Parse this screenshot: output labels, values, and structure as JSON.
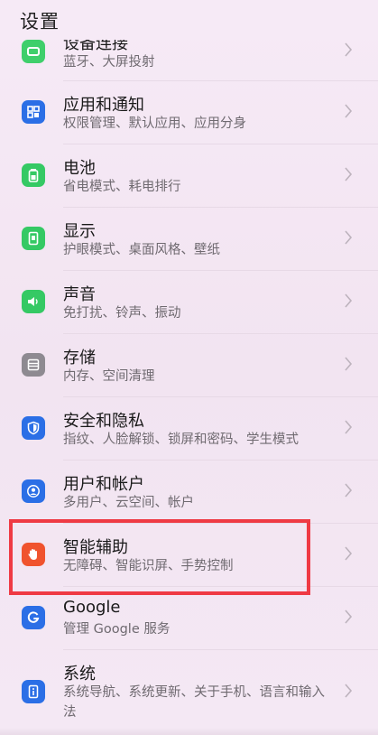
{
  "header": {
    "title": "设置"
  },
  "settings": [
    {
      "title": "设备连接",
      "subtitle": "蓝牙、大屏投射",
      "icon": "device-connection-icon",
      "color": "#3fcf6b"
    },
    {
      "title": "应用和通知",
      "subtitle": "权限管理、默认应用、应用分身",
      "icon": "apps-icon",
      "color": "#2b6fe6"
    },
    {
      "title": "电池",
      "subtitle": "省电模式、耗电排行",
      "icon": "battery-icon",
      "color": "#35c964"
    },
    {
      "title": "显示",
      "subtitle": "护眼模式、桌面风格、壁纸",
      "icon": "display-icon",
      "color": "#35c964"
    },
    {
      "title": "声音",
      "subtitle": "免打扰、铃声、振动",
      "icon": "sound-icon",
      "color": "#35c964"
    },
    {
      "title": "存储",
      "subtitle": "内存、空间清理",
      "icon": "storage-icon",
      "color": "#8e8a91"
    },
    {
      "title": "安全和隐私",
      "subtitle": "指纹、人脸解锁、锁屏和密码、学生模式",
      "icon": "shield-icon",
      "color": "#2b6fe6"
    },
    {
      "title": "用户和帐户",
      "subtitle": "多用户、云空间、帐户",
      "icon": "user-icon",
      "color": "#2b6fe6"
    },
    {
      "title": "智能辅助",
      "subtitle": "无障碍、智能识屏、手势控制",
      "icon": "hand-icon",
      "color": "#f0532e"
    },
    {
      "title": "Google",
      "subtitle": "管理 Google 服务",
      "icon": "google-icon",
      "color": "#2b6fe6"
    },
    {
      "title": "系统",
      "subtitle": "系统导航、系统更新、关于手机、语言和输入法",
      "icon": "system-info-icon",
      "color": "#2b6fe6"
    }
  ],
  "highlight": {
    "color": "#ef3a44"
  }
}
